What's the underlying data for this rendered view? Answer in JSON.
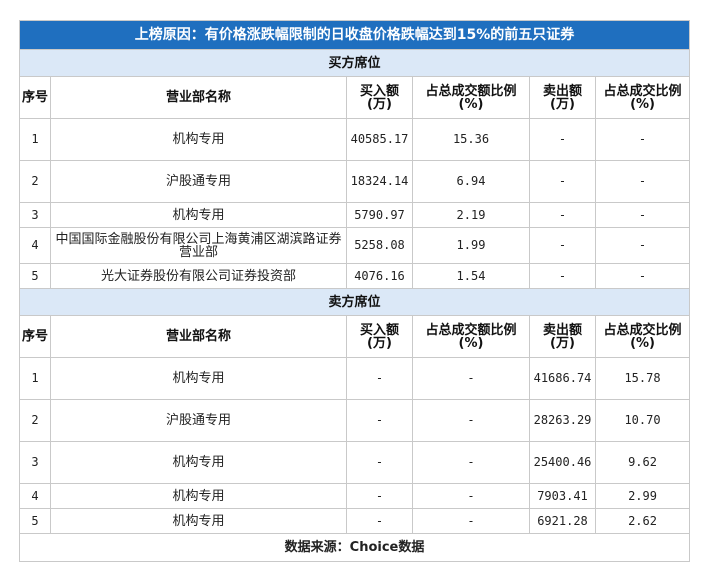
{
  "title": "上榜原因：有价格涨跌幅限制的日收盘价格跌幅达到15%的前五只证券",
  "buy_section": "买方席位",
  "sell_section": "卖方席位",
  "headers": {
    "rank": "序号",
    "name": "营业部名称",
    "buy_amount": "买入额(万)",
    "buy_ratio": "占总成交额比例(%)",
    "sell_amount": "卖出额(万)",
    "sell_ratio": "占总成交比例(%)"
  },
  "buy_rows": [
    {
      "rank": "1",
      "name": "机构专用",
      "buy_amount": "40585.17",
      "buy_ratio": "15.36",
      "sell_amount": "-",
      "sell_ratio": "-"
    },
    {
      "rank": "2",
      "name": "沪股通专用",
      "buy_amount": "18324.14",
      "buy_ratio": "6.94",
      "sell_amount": "-",
      "sell_ratio": "-"
    },
    {
      "rank": "3",
      "name": "机构专用",
      "buy_amount": "5790.97",
      "buy_ratio": "2.19",
      "sell_amount": "-",
      "sell_ratio": "-"
    },
    {
      "rank": "4",
      "name": "中国国际金融股份有限公司上海黄浦区湖滨路证券营业部",
      "buy_amount": "5258.08",
      "buy_ratio": "1.99",
      "sell_amount": "-",
      "sell_ratio": "-"
    },
    {
      "rank": "5",
      "name": "光大证券股份有限公司证券投资部",
      "buy_amount": "4076.16",
      "buy_ratio": "1.54",
      "sell_amount": "-",
      "sell_ratio": "-"
    }
  ],
  "sell_rows": [
    {
      "rank": "1",
      "name": "机构专用",
      "buy_amount": "-",
      "buy_ratio": "-",
      "sell_amount": "41686.74",
      "sell_ratio": "15.78"
    },
    {
      "rank": "2",
      "name": "沪股通专用",
      "buy_amount": "-",
      "buy_ratio": "-",
      "sell_amount": "28263.29",
      "sell_ratio": "10.70"
    },
    {
      "rank": "3",
      "name": "机构专用",
      "buy_amount": "-",
      "buy_ratio": "-",
      "sell_amount": "25400.46",
      "sell_ratio": "9.62"
    },
    {
      "rank": "4",
      "name": "机构专用",
      "buy_amount": "-",
      "buy_ratio": "-",
      "sell_amount": "7903.41",
      "sell_ratio": "2.99"
    },
    {
      "rank": "5",
      "name": "机构专用",
      "buy_amount": "-",
      "buy_ratio": "-",
      "sell_amount": "6921.28",
      "sell_ratio": "2.62"
    }
  ],
  "footer": "数据来源：Choice数据"
}
